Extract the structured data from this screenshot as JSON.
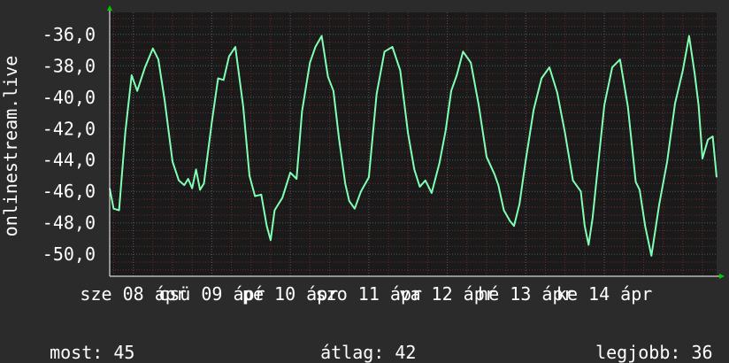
{
  "chart_data": {
    "type": "line",
    "ylabel": "onlinestream.live",
    "ylim": [
      -51.4,
      -34.6
    ],
    "yticks": [
      -36,
      -38,
      -40,
      -42,
      -44,
      -46,
      -48,
      -50
    ],
    "ytick_labels": [
      "-36,0",
      "-38,0",
      "-40,0",
      "-42,0",
      "-44,0",
      "-46,0",
      "-48,0",
      "-50,0"
    ],
    "xlim": [
      0,
      7.73
    ],
    "xticks": [
      0.3,
      1.3,
      2.3,
      3.3,
      4.3,
      5.3,
      6.3
    ],
    "xtick_labels": [
      "sze 08 ápr",
      "csü 09 ápr",
      "pé 10 ápr",
      "szo 11 ápr",
      "va 12 ápr",
      "hé 13 ápr",
      "ke 14 ápr"
    ],
    "grid": true,
    "colors": {
      "background": "#2b2b2b",
      "plot": "#1a1a1a",
      "line": "#80ffb4",
      "grid": "#555555",
      "grid_minor": "#6b2a2a",
      "axis": "#ffffff",
      "arrow": "#00cc00"
    },
    "series": [
      {
        "x": [
          0,
          0.05,
          0.12,
          0.2,
          0.28,
          0.35,
          0.45,
          0.55,
          0.62,
          0.7,
          0.8,
          0.88,
          0.95,
          1.0,
          1.05,
          1.1,
          1.15,
          1.2,
          1.3,
          1.38,
          1.45,
          1.52,
          1.6,
          1.7,
          1.78,
          1.85,
          1.93,
          2.0,
          2.05,
          2.1,
          2.2,
          2.3,
          2.38,
          2.45,
          2.55,
          2.62,
          2.7,
          2.78,
          2.85,
          2.92,
          3.0,
          3.05,
          3.12,
          3.2,
          3.3,
          3.4,
          3.5,
          3.6,
          3.7,
          3.8,
          3.88,
          3.95,
          4.02,
          4.1,
          4.2,
          4.28,
          4.35,
          4.42,
          4.5,
          4.6,
          4.7,
          4.8,
          4.9,
          4.95,
          5.02,
          5.1,
          5.15,
          5.22,
          5.3,
          5.4,
          5.5,
          5.6,
          5.7,
          5.8,
          5.9,
          6.0,
          6.05,
          6.1,
          6.15,
          6.2,
          6.3,
          6.4,
          6.5,
          6.6,
          6.7,
          6.75,
          6.82,
          6.9,
          7.0,
          7.1,
          7.2,
          7.3,
          7.38,
          7.45,
          7.5,
          7.55,
          7.62,
          7.68,
          7.73
        ],
        "y": [
          -45.8,
          -47.1,
          -47.2,
          -42.2,
          -38.6,
          -39.6,
          -38.1,
          -36.9,
          -37.6,
          -40.2,
          -44.1,
          -45.3,
          -45.6,
          -45.2,
          -45.8,
          -44.6,
          -45.9,
          -45.5,
          -41.6,
          -38.8,
          -38.9,
          -37.4,
          -36.8,
          -40.6,
          -45.0,
          -46.3,
          -46.2,
          -48.2,
          -49.1,
          -47.2,
          -46.4,
          -44.8,
          -45.2,
          -40.9,
          -37.8,
          -36.8,
          -36.1,
          -38.7,
          -39.6,
          -42.6,
          -45.5,
          -46.6,
          -47.1,
          -46.0,
          -45.1,
          -39.8,
          -37.1,
          -36.8,
          -38.3,
          -42.3,
          -44.6,
          -45.7,
          -45.3,
          -46.1,
          -44.2,
          -42.1,
          -39.6,
          -38.6,
          -37.1,
          -37.8,
          -40.5,
          -43.8,
          -44.9,
          -45.6,
          -47.2,
          -47.9,
          -48.2,
          -46.8,
          -44.0,
          -40.8,
          -38.8,
          -38.1,
          -39.7,
          -42.3,
          -45.3,
          -46.0,
          -48.2,
          -49.4,
          -47.7,
          -45.3,
          -40.5,
          -38.1,
          -37.6,
          -40.6,
          -45.4,
          -45.9,
          -48.2,
          -50.1,
          -46.8,
          -44.1,
          -40.4,
          -38.3,
          -36.1,
          -38.5,
          -40.5,
          -43.9,
          -42.7,
          -42.5,
          -45.1
        ]
      }
    ],
    "stats": [
      {
        "label": "most:",
        "value": "45"
      },
      {
        "label": "átlag:",
        "value": "42"
      },
      {
        "label": "legjobb:",
        "value": "36"
      }
    ]
  }
}
